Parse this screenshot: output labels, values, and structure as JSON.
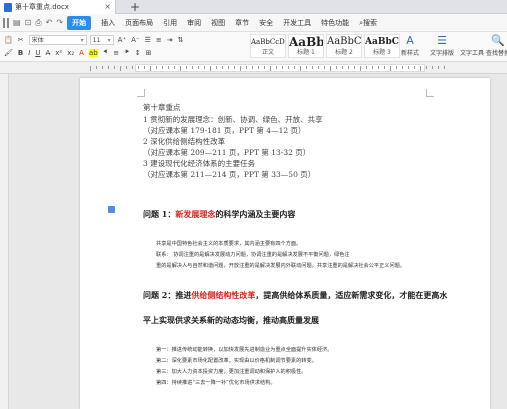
{
  "tabbar": {
    "doc_title": "第十章重点.docx",
    "close": "×",
    "new_tab": "+"
  },
  "menubar": {
    "items": [
      "开始",
      "插入",
      "页面布局",
      "引用",
      "审阅",
      "视图",
      "章节",
      "安全",
      "开发工具",
      "特色功能"
    ],
    "search": "搜索"
  },
  "ribbon": {
    "font_name": "宋体",
    "font_size": "11",
    "styles": [
      {
        "sample": "AaBbCcDd",
        "label": "正文"
      },
      {
        "sample": "AaBb",
        "label": "标题 1"
      },
      {
        "sample": "AaBbC",
        "label": "标题 2"
      },
      {
        "sample": "AaBbC",
        "label": "标题 3"
      }
    ],
    "buttons": [
      {
        "label": "新样式",
        "icon": "A"
      },
      {
        "label": "文字排版",
        "icon": "☰"
      },
      {
        "label": "查找替换",
        "icon": "🔍"
      }
    ],
    "text_tool": "文字工具"
  },
  "document": {
    "heading": "第十章重点",
    "outline": [
      "1 贯彻新的发展理念：创新、协调、绿色、开放、共享",
      "（对应课本第 179-181 页，PPT 第 4—12 页）",
      "2 深化供给侧结构性改革",
      "（对应课本第 209—211 页，PPT 第 13-32 页）",
      "3 建设现代化经济体系的主要任务",
      "（对应课本第 211—214 页，PPT 第 33—50 页）"
    ],
    "q1": {
      "pre": "问题 1：",
      "red": "新发展理念",
      "post": "的科学内涵及主要内容"
    },
    "q1_body": [
      "共享是中国特色社会主义的本质要求，其内涵主要有四个方面。",
      "联系：            协调注重的是解决发展动力问题，协调注重的是解决发展不平衡问题，绿色注",
      "重的是解决人与自然和谐问题，开放注重的是解决发展内外联动问题，共享注重的是解决社会公平正义问题。"
    ],
    "q2": {
      "pre": "问题 2：推进",
      "red": "供给侧结构性改革",
      "post": "，提高供给体系质量，适应新需求变化，才能在更高水"
    },
    "q2_line2": "平上实现供求关系新的动态均衡，推动高质量发展",
    "q2_body": [
      "第一：推进传统动能转换，以加快发展先进制造业为重点全面提升实体经济。",
      "第二：深化要素市场化配置改革，实现由以价格机制调节要素的转变。",
      "第三：加大人力资本投资力度，更加注重调动和保护人的积极性。",
      "第四：持续推进“三去一降一补”优化市场供求结构。"
    ]
  }
}
